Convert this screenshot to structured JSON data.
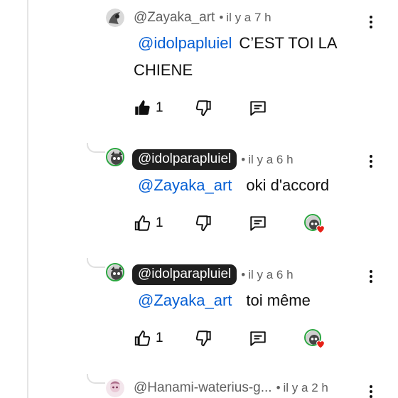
{
  "comments": [
    {
      "author": "@Zayaka_art",
      "time": "il y a 7 h",
      "mention": "@idolpapluiel",
      "text": "C’EST TOI LA CHIENE",
      "like_count": "1",
      "liked": true,
      "author_highlighted": false,
      "creator_heart": false
    },
    {
      "author": "@idolparapluiel",
      "time": "il y a 6 h",
      "mention": "@Zayaka_art",
      "text": "oki d'accord",
      "like_count": "1",
      "liked": false,
      "author_highlighted": true,
      "creator_heart": true
    },
    {
      "author": "@idolparapluiel",
      "time": "il y a 6 h",
      "mention": "@Zayaka_art",
      "text": "toi même",
      "like_count": "1",
      "liked": false,
      "author_highlighted": true,
      "creator_heart": true
    },
    {
      "author": "@Hanami-waterius-g...",
      "time": "il y a 2 h",
      "author_highlighted": false
    }
  ],
  "icons": {
    "like": "thumbs-up-icon",
    "dislike": "thumbs-down-icon",
    "reply": "reply-icon",
    "menu": "more-vert-icon",
    "heart": "creator-heart-icon"
  },
  "colors": {
    "mention": "#065fd4",
    "meta": "#606060",
    "heart": "#e62117",
    "avatar_ring": "#2ba640"
  }
}
